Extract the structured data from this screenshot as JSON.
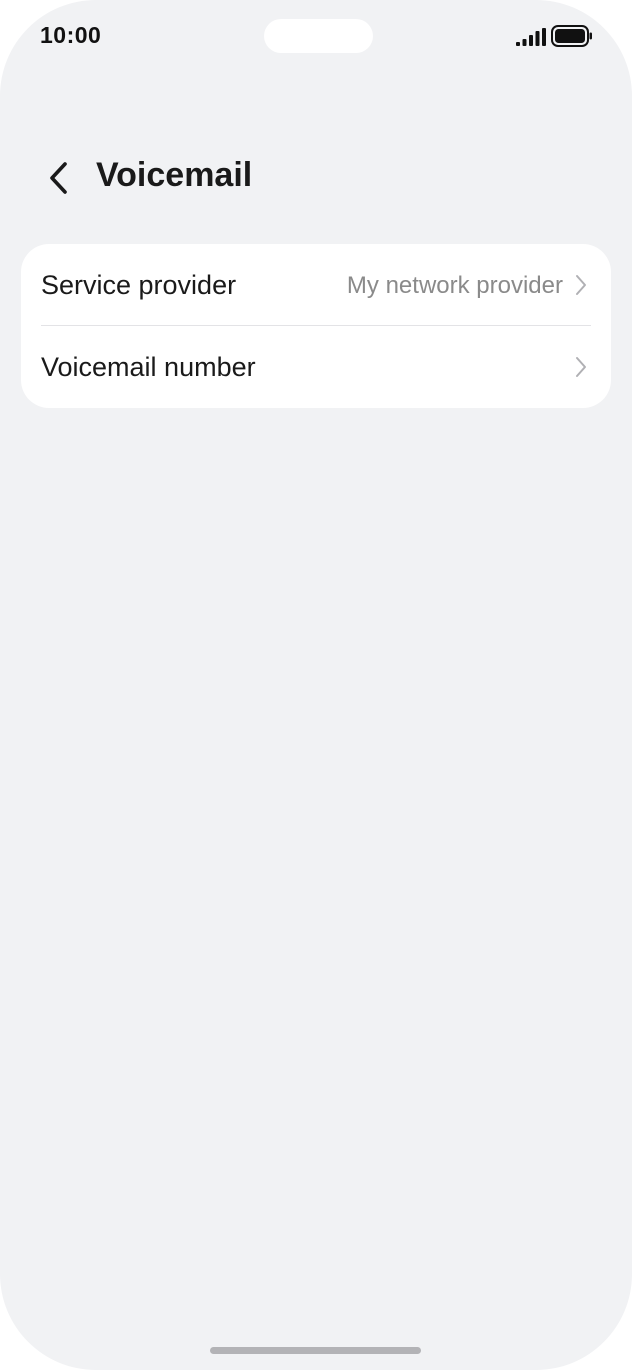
{
  "status_bar": {
    "time": "10:00",
    "signal_icon": "signal-bars-icon",
    "battery_icon": "battery-full-icon"
  },
  "header": {
    "back_icon": "chevron-left-icon",
    "title": "Voicemail"
  },
  "settings": {
    "rows": [
      {
        "label": "Service provider",
        "value": "My network provider",
        "icon": "chevron-right-icon"
      },
      {
        "label": "Voicemail number",
        "value": "",
        "icon": "chevron-right-icon"
      }
    ]
  },
  "colors": {
    "background": "#f1f2f4",
    "card": "#ffffff",
    "text_primary": "#1a1a1a",
    "text_secondary": "#8a8a8a"
  }
}
